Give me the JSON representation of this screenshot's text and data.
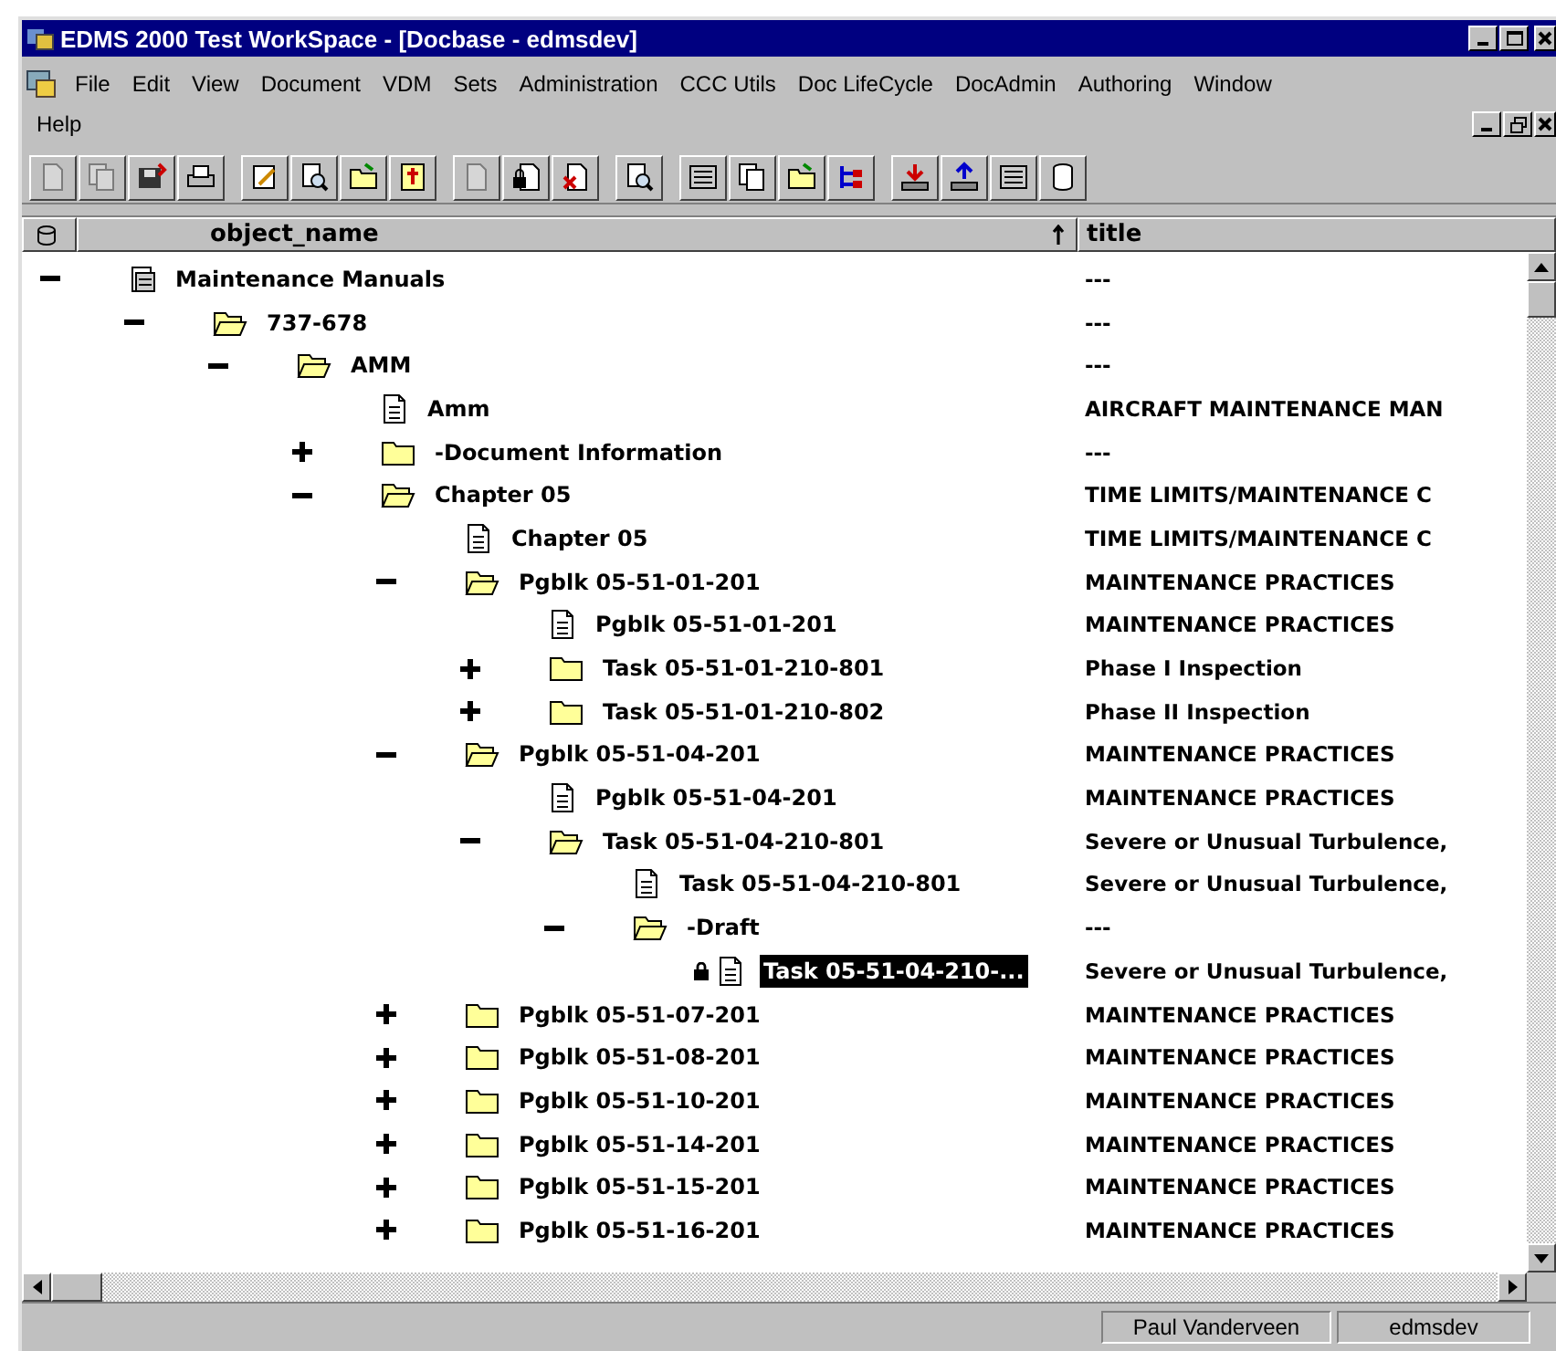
{
  "window": {
    "title": "EDMS 2000 Test WorkSpace - [Docbase - edmsdev]"
  },
  "menu": [
    "File",
    "Edit",
    "View",
    "Document",
    "VDM",
    "Sets",
    "Administration",
    "CCC Utils",
    "Doc LifeCycle",
    "DocAdmin",
    "Authoring",
    "Window",
    "Help"
  ],
  "columns": [
    {
      "label": "object_name",
      "sorted": true
    },
    {
      "label": "title",
      "sorted": false
    }
  ],
  "tree": [
    {
      "name": "Maintenance Manuals",
      "title": "---",
      "kind": "cabinet",
      "expanded": true,
      "selected": false,
      "children": [
        {
          "name": "737-678",
          "title": "---",
          "kind": "folder",
          "expanded": true,
          "selected": false,
          "children": [
            {
              "name": "AMM",
              "title": "---",
              "kind": "folder",
              "expanded": true,
              "selected": false,
              "children": [
                {
                  "name": "Amm",
                  "title": "AIRCRAFT MAINTENANCE MAN",
                  "kind": "document",
                  "selected": false
                },
                {
                  "name": "-Document Information",
                  "title": "---",
                  "kind": "folder",
                  "expanded": false,
                  "selected": false
                },
                {
                  "name": "Chapter 05",
                  "title": "TIME LIMITS/MAINTENANCE C",
                  "kind": "folder",
                  "expanded": true,
                  "selected": false,
                  "children": [
                    {
                      "name": "Chapter 05",
                      "title": "TIME LIMITS/MAINTENANCE C",
                      "kind": "document",
                      "selected": false
                    },
                    {
                      "name": "Pgblk 05-51-01-201",
                      "title": "MAINTENANCE PRACTICES",
                      "kind": "folder",
                      "expanded": true,
                      "selected": false,
                      "children": [
                        {
                          "name": "Pgblk 05-51-01-201",
                          "title": "MAINTENANCE PRACTICES",
                          "kind": "document",
                          "selected": false
                        },
                        {
                          "name": "Task 05-51-01-210-801",
                          "title": "Phase I Inspection",
                          "kind": "folder",
                          "expanded": false,
                          "selected": false
                        },
                        {
                          "name": "Task 05-51-01-210-802",
                          "title": "Phase II Inspection",
                          "kind": "folder",
                          "expanded": false,
                          "selected": false
                        }
                      ]
                    },
                    {
                      "name": "Pgblk 05-51-04-201",
                      "title": "MAINTENANCE PRACTICES",
                      "kind": "folder",
                      "expanded": true,
                      "selected": false,
                      "children": [
                        {
                          "name": "Pgblk 05-51-04-201",
                          "title": "MAINTENANCE PRACTICES",
                          "kind": "document",
                          "selected": false
                        },
                        {
                          "name": "Task 05-51-04-210-801",
                          "title": "Severe or Unusual Turbulence,",
                          "kind": "folder",
                          "expanded": true,
                          "selected": false,
                          "children": [
                            {
                              "name": "Task 05-51-04-210-801",
                              "title": "Severe or Unusual Turbulence,",
                              "kind": "document",
                              "selected": false
                            },
                            {
                              "name": "-Draft",
                              "title": "---",
                              "kind": "folder",
                              "expanded": true,
                              "selected": false,
                              "children": [
                                {
                                  "name": "Task 05-51-04-210-...",
                                  "title": "Severe or Unusual Turbulence,",
                                  "kind": "document",
                                  "selected": true,
                                  "locked": true
                                }
                              ]
                            }
                          ]
                        }
                      ]
                    },
                    {
                      "name": "Pgblk 05-51-07-201",
                      "title": "MAINTENANCE PRACTICES",
                      "kind": "folder",
                      "expanded": false,
                      "selected": false
                    },
                    {
                      "name": "Pgblk 05-51-08-201",
                      "title": "MAINTENANCE PRACTICES",
                      "kind": "folder",
                      "expanded": false,
                      "selected": false
                    },
                    {
                      "name": "Pgblk 05-51-10-201",
                      "title": "MAINTENANCE PRACTICES",
                      "kind": "folder",
                      "expanded": false,
                      "selected": false
                    },
                    {
                      "name": "Pgblk 05-51-14-201",
                      "title": "MAINTENANCE PRACTICES",
                      "kind": "folder",
                      "expanded": false,
                      "selected": false
                    },
                    {
                      "name": "Pgblk 05-51-15-201",
                      "title": "MAINTENANCE PRACTICES",
                      "kind": "folder",
                      "expanded": false,
                      "selected": false
                    },
                    {
                      "name": "Pgblk 05-51-16-201",
                      "title": "MAINTENANCE PRACTICES",
                      "kind": "folder",
                      "expanded": false,
                      "selected": false
                    }
                  ]
                }
              ]
            }
          ]
        }
      ]
    }
  ],
  "status_bar": [
    "Paul Vanderveen",
    "edmsdev"
  ]
}
